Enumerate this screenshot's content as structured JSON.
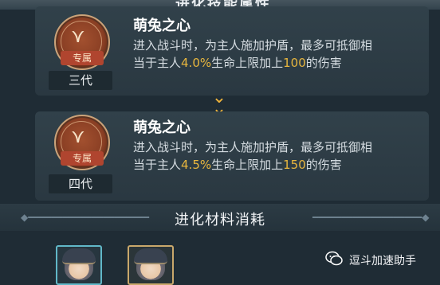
{
  "header": {
    "partial_title": "进化技能属性"
  },
  "cards": [
    {
      "badge_tag": "专属",
      "generation": "三代",
      "skill_name": "萌兔之心",
      "desc_line1": "进入战斗时，为主人施加护盾，最多可抵御相",
      "desc_line2_pre": "当于主人",
      "percent": "4.0%",
      "desc_line2_mid": "生命上限加上",
      "flat": "100",
      "desc_line2_post": "的伤害"
    },
    {
      "badge_tag": "专属",
      "generation": "四代",
      "skill_name": "萌兔之心",
      "desc_line1": "进入战斗时，为主人施加护盾，最多可抵御相",
      "desc_line2_pre": "当于主人",
      "percent": "4.5%",
      "desc_line2_mid": "生命上限加上",
      "flat": "150",
      "desc_line2_post": "的伤害"
    }
  ],
  "arrow_icon": "double-chevron-down-icon",
  "section": {
    "title": "进化材料消耗"
  },
  "materials": [
    {
      "frame_color": "#61b8c8",
      "icon": "character-portrait-icon"
    },
    {
      "frame_color": "#c9a86b",
      "icon": "character-portrait-icon"
    }
  ],
  "watermark": {
    "icon": "wechat-icon",
    "text": "逗斗加速助手"
  },
  "colors": {
    "highlight": "#e8b63e",
    "badge": "#a2502f",
    "arrow": "#f0b43b"
  }
}
